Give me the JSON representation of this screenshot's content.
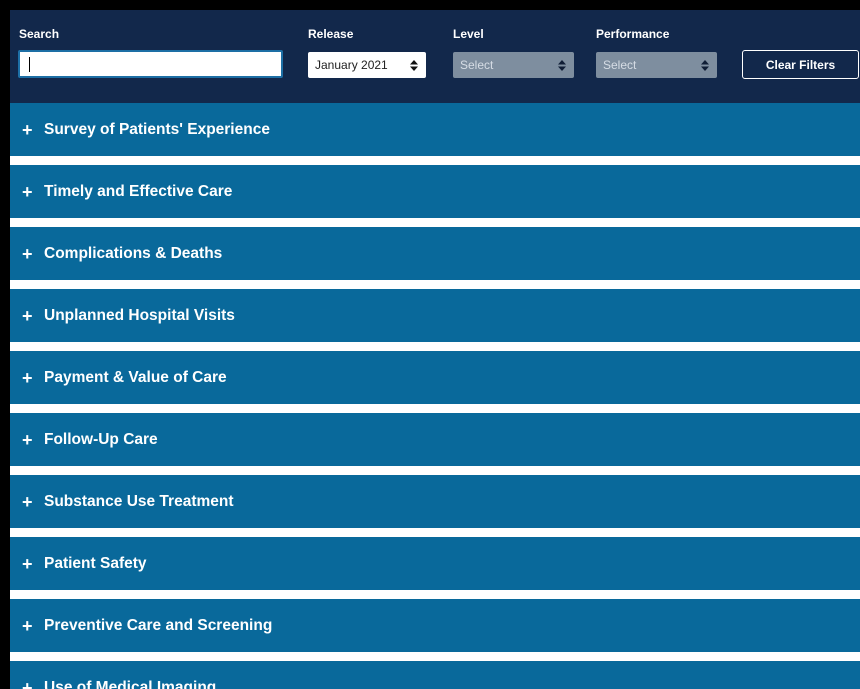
{
  "filters": {
    "search": {
      "label": "Search",
      "value": "",
      "placeholder": ""
    },
    "release": {
      "label": "Release",
      "selected": "January 2021"
    },
    "level": {
      "label": "Level",
      "selected": "Select"
    },
    "performance": {
      "label": "Performance",
      "selected": "Select"
    },
    "clear_label": "Clear Filters"
  },
  "sections": [
    {
      "label": "Survey of Patients' Experience"
    },
    {
      "label": "Timely and Effective Care"
    },
    {
      "label": "Complications & Deaths"
    },
    {
      "label": "Unplanned Hospital Visits"
    },
    {
      "label": "Payment & Value of Care"
    },
    {
      "label": "Follow-Up Care"
    },
    {
      "label": "Substance Use Treatment"
    },
    {
      "label": "Patient Safety"
    },
    {
      "label": "Preventive Care and Screening"
    },
    {
      "label": "Use of Medical Imaging"
    }
  ],
  "icons": {
    "expand": "plus-icon",
    "select": "sort-arrows-icon"
  },
  "colors": {
    "header_bg": "#12284b",
    "section_bg": "#09699b",
    "disabled_select_bg": "#7e8e9f"
  }
}
